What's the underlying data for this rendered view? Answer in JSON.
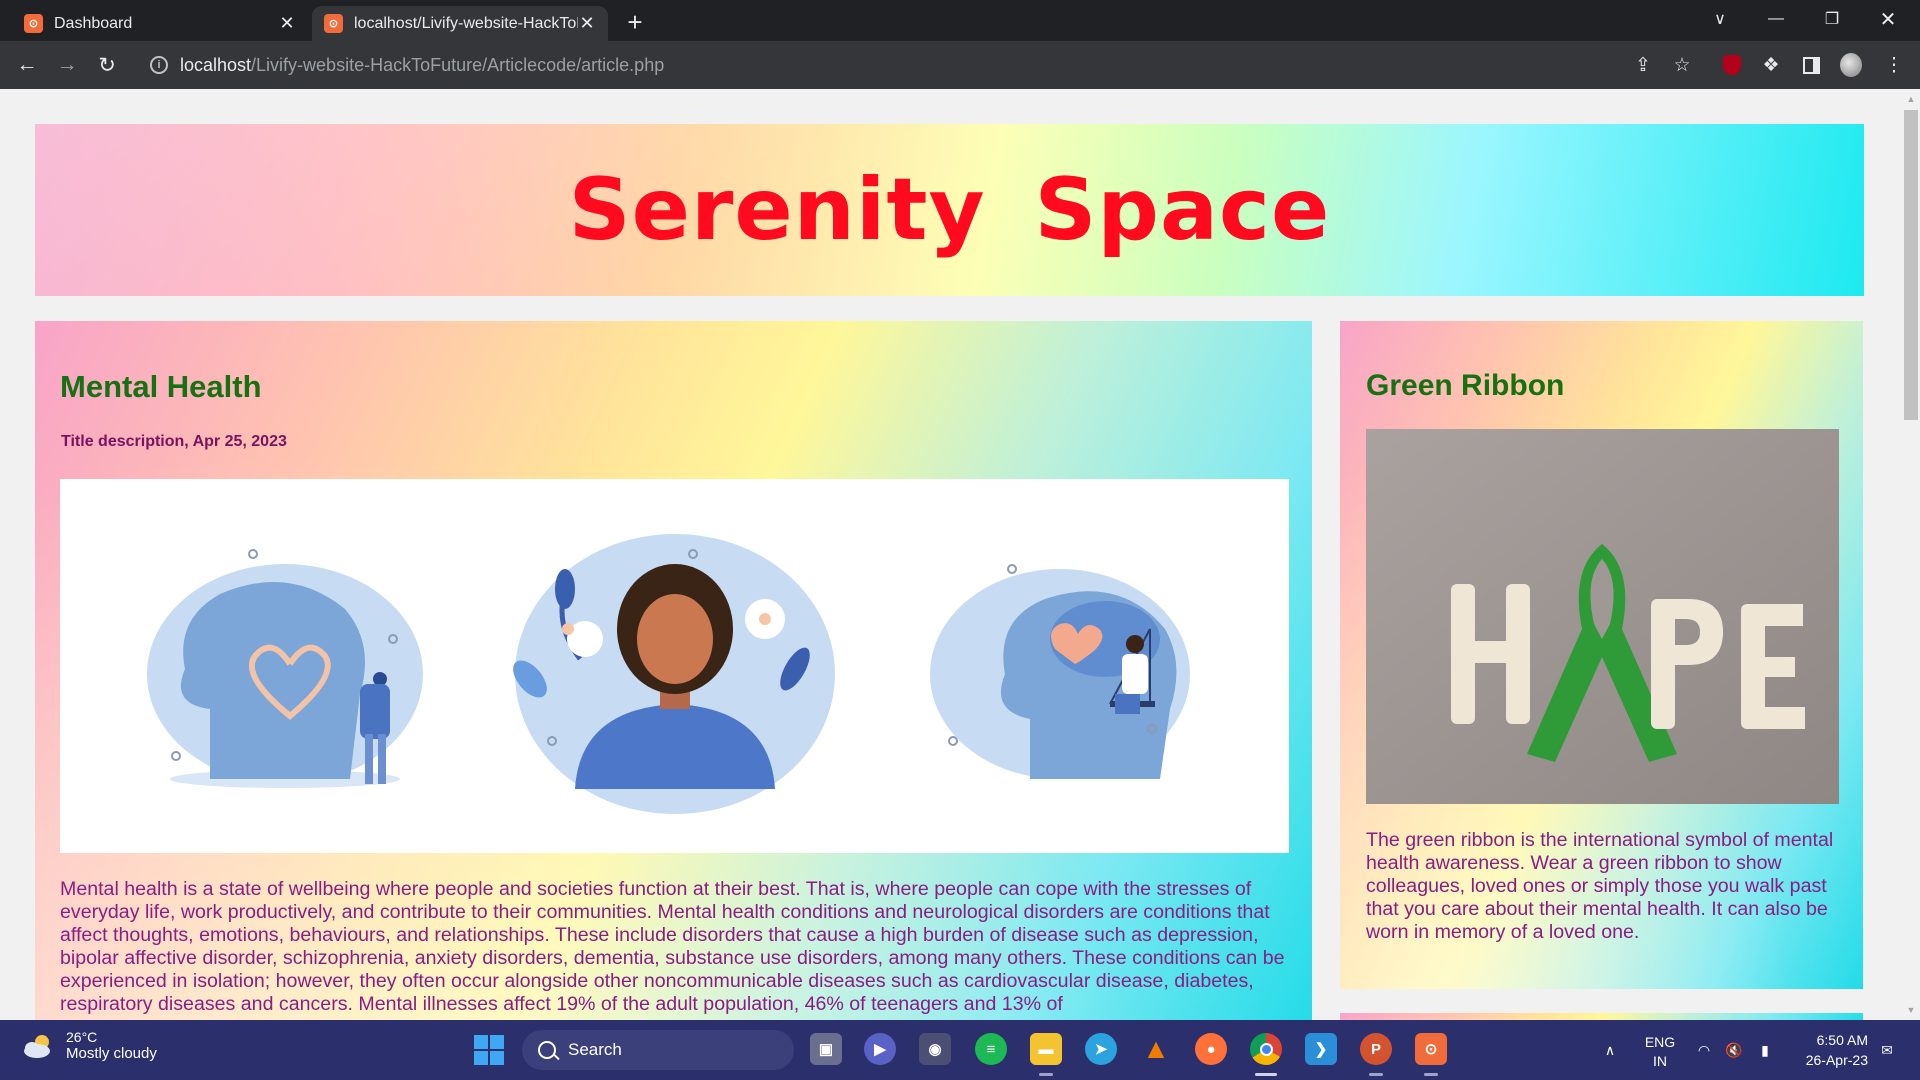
{
  "browser": {
    "tabs": [
      {
        "title": "Dashboard",
        "favicon": "xampp-icon"
      },
      {
        "title": "localhost/Livify-website-HackToF",
        "favicon": "xampp-icon"
      }
    ],
    "url_host": "localhost",
    "url_path": "/Livify-website-HackToFuture/Articlecode/article.php"
  },
  "site": {
    "title": "Serenity Space"
  },
  "article": {
    "heading": "Mental Health",
    "meta": "Title description, Apr 25, 2023",
    "body": "Mental health is a state of wellbeing where people and societies function at their best. That is, where people can cope with the stresses of everyday life, work productively, and contribute to their communities. Mental health conditions and neurological disorders are conditions that affect thoughts, emotions, behaviours, and relationships. These include disorders that cause a high burden of disease such as depression, bipolar affective disorder, schizophrenia, anxiety disorders, dementia, substance use disorders, among many others. These conditions can be experienced in isolation; however, they often occur alongside other noncommunicable diseases such as cardiovascular disease, diabetes, respiratory diseases and cancers. Mental illnesses affect 19% of the adult population, 46% of teenagers and 13% of"
  },
  "sidebar": {
    "heading": "Green Ribbon",
    "body": "The green ribbon is the international symbol of mental health awareness. Wear a green ribbon to show colleagues, loved ones or simply those you walk past that you care about their mental health. It can also be worn in memory of a loved one."
  },
  "taskbar": {
    "weather_temp": "26°C",
    "weather_text": "Mostly cloudy",
    "search_label": "Search",
    "lang_line1": "ENG",
    "lang_line2": "IN",
    "time": "6:50 AM",
    "date": "26-Apr-23"
  },
  "colors": {
    "title_red": "#ff0a1e",
    "heading_green": "#177012",
    "body_purple": "#8a1d82",
    "taskbar_bg": "#2b2f6b"
  }
}
